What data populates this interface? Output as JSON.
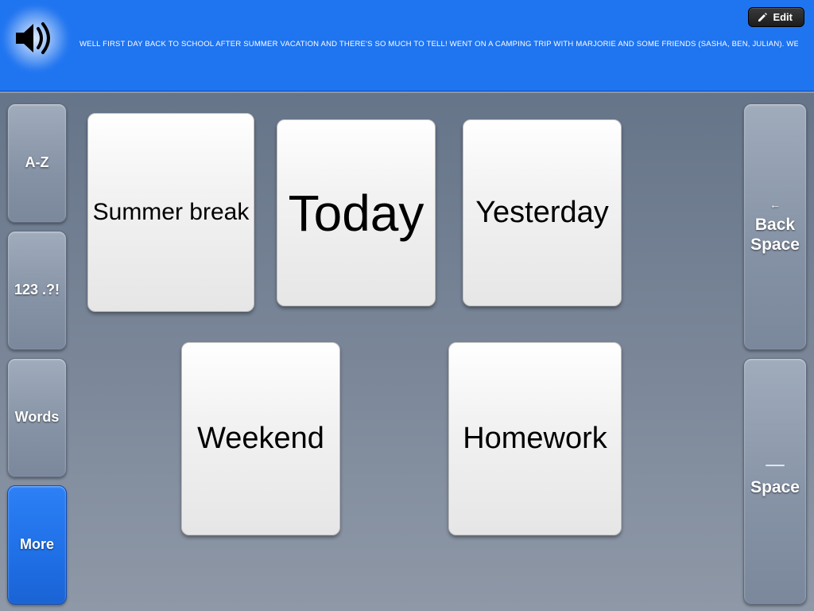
{
  "topbar": {
    "edit_label": "Edit",
    "ticker_text": "WELL FIRST DAY BACK TO SCHOOL AFTER SUMMER VACATION AND THERE'S SO MUCH TO TELL! WENT ON A CAMPING TRIP WITH MARJORIE AND SOME FRIENDS (SASHA, BEN, JULIAN). WENT TO OVERNIGHT CAMP"
  },
  "left_buttons": {
    "az": "A-Z",
    "nums": "123 .?!",
    "words": "Words",
    "more": "More"
  },
  "right_buttons": {
    "backspace_arrow": "←",
    "backspace_line1": "Back",
    "backspace_line2": "Space",
    "space": "Space"
  },
  "tiles": {
    "summer": "Summer break",
    "today": "Today",
    "yesterday": "Yesterday",
    "weekend": "Weekend",
    "homework": "Homework"
  }
}
